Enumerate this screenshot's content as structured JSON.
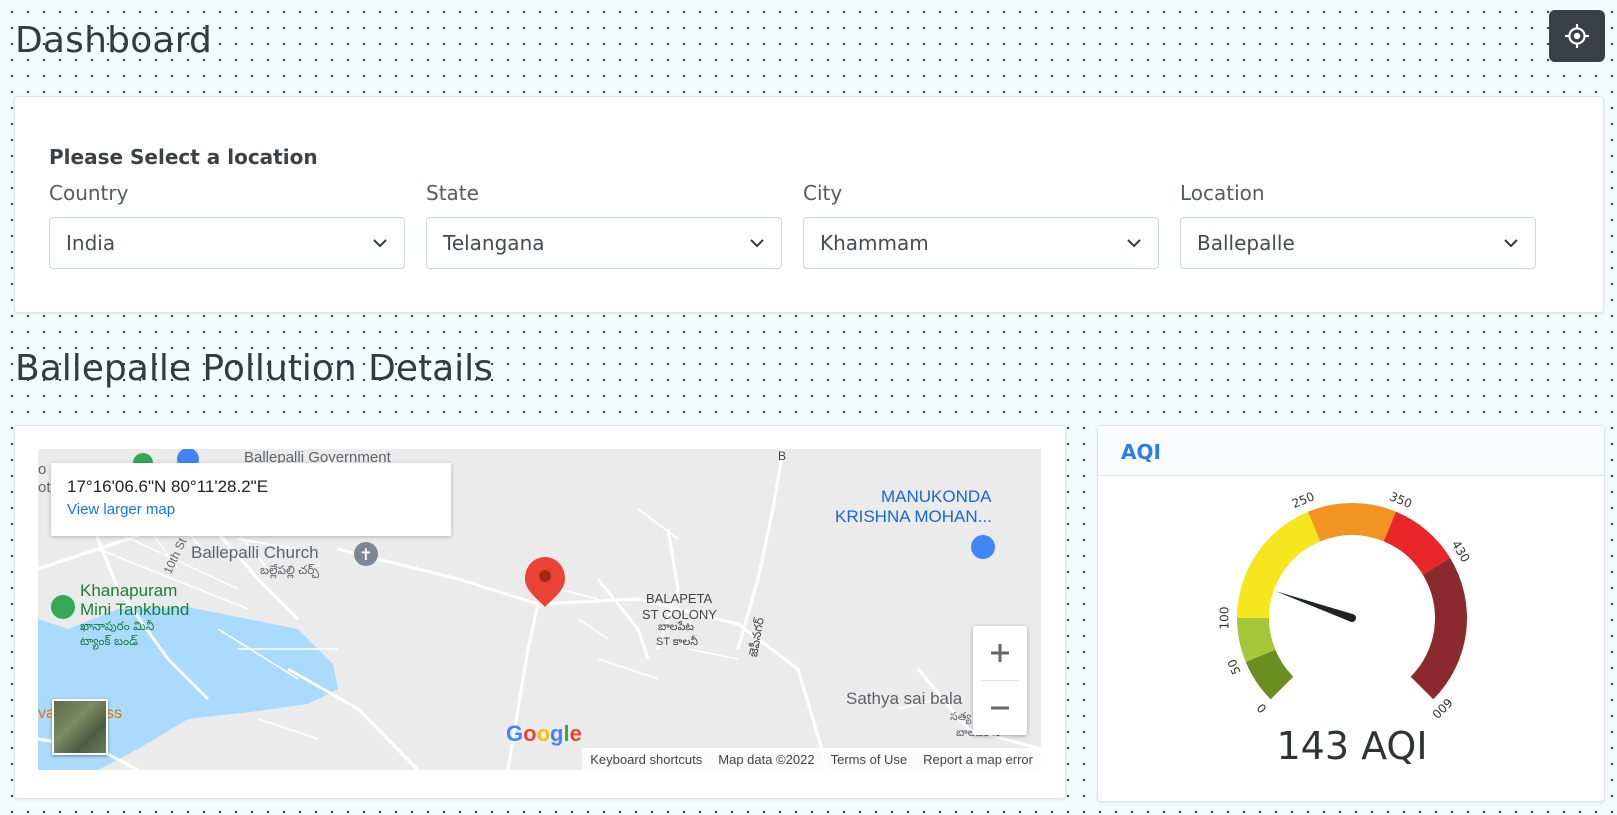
{
  "header": {
    "title": "Dashboard",
    "locate_icon": "crosshair-icon"
  },
  "selector": {
    "heading": "Please Select a location",
    "fields": [
      {
        "label": "Country",
        "value": "India"
      },
      {
        "label": "State",
        "value": "Telangana"
      },
      {
        "label": "City",
        "value": "Khammam"
      },
      {
        "label": "Location",
        "value": "Ballepalle"
      }
    ]
  },
  "section_title": "Ballepalle Pollution Details",
  "map": {
    "coordinates": "17°16'06.6\"N 80°11'28.2\"E",
    "view_larger": "View larger map",
    "labels": {
      "govt": "Ballepalli Government",
      "manukonda_1": "MANUKONDA",
      "manukonda_2": "KRISHNA MOHAN...",
      "church_en": "Ballepalli Church",
      "church_te": "బల్లేపల్లి చర్చ్",
      "khana_1": "Khanapuram",
      "khana_2": "Mini Tankbund",
      "khana_te_1": "ఖానాపురం మినీ",
      "khana_te_2": "ట్యాంక్ బండ్",
      "balapeta_1": "BALAPETA",
      "balapeta_2": "ST COLONY",
      "balapeta_te_1": "బాలపేట",
      "balapeta_te_2": "ST కాలనీ",
      "street_10": "10th St",
      "sathya": "Sathya sai bala",
      "sathya_te": "సత్య",
      "sathya_te_2": "బాలవికాస",
      "road_b": "B",
      "road_te": "జెపీనగర్",
      "ss": "ss",
      "va": "va",
      "o": "o",
      "ot": "ot"
    },
    "google": [
      "G",
      "o",
      "o",
      "g",
      "l",
      "e"
    ],
    "attribution": {
      "shortcuts": "Keyboard shortcuts",
      "data": "Map data ©2022",
      "terms": "Terms of Use",
      "report": "Report a map error"
    }
  },
  "aqi": {
    "header": "AQI",
    "value": 143,
    "value_text": "143 AQI",
    "gauge": {
      "min": 0,
      "max": 600,
      "ticks": [
        "0",
        "50",
        "100",
        "250",
        "350",
        "430",
        "600"
      ],
      "bands": [
        {
          "from": 0,
          "to": 50,
          "color": "#6b8e23"
        },
        {
          "from": 50,
          "to": 100,
          "color": "#a4c639"
        },
        {
          "from": 100,
          "to": 250,
          "color": "#f5e61e"
        },
        {
          "from": 250,
          "to": 350,
          "color": "#f39322"
        },
        {
          "from": 350,
          "to": 430,
          "color": "#e8262a"
        },
        {
          "from": 430,
          "to": 600,
          "color": "#8b2a2e"
        }
      ]
    }
  }
}
